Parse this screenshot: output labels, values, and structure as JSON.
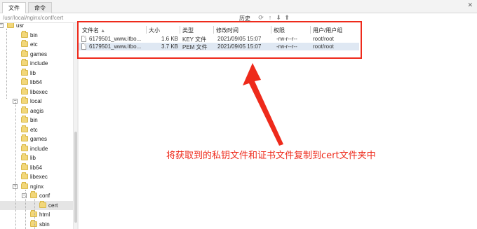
{
  "tabs": {
    "files": "文件",
    "commands": "命令"
  },
  "path": "/usr/local/nginx/conf/cert",
  "toolbar": {
    "history": "历史"
  },
  "tree": [
    {
      "label": "usr",
      "level": 0
    },
    {
      "label": "bin",
      "level": 1
    },
    {
      "label": "etc",
      "level": 1
    },
    {
      "label": "games",
      "level": 1
    },
    {
      "label": "include",
      "level": 1
    },
    {
      "label": "lib",
      "level": 1
    },
    {
      "label": "lib64",
      "level": 1
    },
    {
      "label": "libexec",
      "level": 1
    },
    {
      "label": "local",
      "level": 1
    },
    {
      "label": "aegis",
      "level": 2
    },
    {
      "label": "bin",
      "level": 2
    },
    {
      "label": "etc",
      "level": 2
    },
    {
      "label": "games",
      "level": 2
    },
    {
      "label": "include",
      "level": 2
    },
    {
      "label": "lib",
      "level": 2
    },
    {
      "label": "lib64",
      "level": 2
    },
    {
      "label": "libexec",
      "level": 2
    },
    {
      "label": "nginx",
      "level": 2
    },
    {
      "label": "conf",
      "level": 3
    },
    {
      "label": "cert",
      "level": 4,
      "selected": true
    },
    {
      "label": "html",
      "level": 3
    },
    {
      "label": "sbin",
      "level": 3
    }
  ],
  "file_columns": {
    "name": "文件名",
    "sort_marker": "▲",
    "size": "大小",
    "type": "类型",
    "modified": "修改时间",
    "perms": "权限",
    "owner": "用户/用户组"
  },
  "files": [
    {
      "name": "6179501_www.itbo...",
      "size": "1.6 KB",
      "type": "KEY 文件",
      "modified": "2021/09/05 15:07",
      "perms": "-rw-r--r--",
      "owner": "root/root"
    },
    {
      "name": "6179501_www.itbo...",
      "size": "3.7 KB",
      "type": "PEM 文件",
      "modified": "2021/09/05 15:07",
      "perms": "-rw-r--r--",
      "owner": "root/root"
    }
  ],
  "annotation": "将获取到的私钥文件和证书文件复制到cert文件夹中",
  "colors": {
    "annotation": "#ee2a1b",
    "selected_row": "#dfe8f3",
    "folder": "#f2d77a"
  }
}
